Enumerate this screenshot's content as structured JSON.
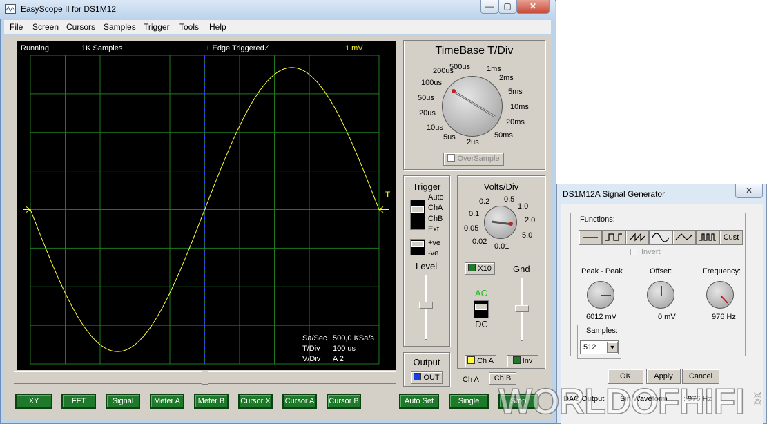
{
  "window": {
    "title": "EasyScope II for DS1M12",
    "minimize": "—",
    "maximize": "▢",
    "close": "✕"
  },
  "menu": [
    "File",
    "Screen",
    "Cursors",
    "Samples",
    "Trigger",
    "Tools",
    "Help"
  ],
  "screen": {
    "status": "Running",
    "samples": "1K Samples",
    "trigger": "+ Edge Triggered  ⁄",
    "volts": "1 mV",
    "trigger_marker": "T",
    "info": [
      {
        "label": "Sa/Sec",
        "value": "500,0 KSa/s"
      },
      {
        "label": "T/Div",
        "value": "100 us"
      },
      {
        "label": "V/Div",
        "value": "A 2"
      }
    ],
    "colors": {
      "grid": "#1f7a1f",
      "trace": "#ffff33",
      "axis": "#3b3bff",
      "marker": "#ffff33"
    }
  },
  "timebase": {
    "title": "TimeBase T/Div",
    "labels": [
      "500us",
      "1ms",
      "2ms",
      "5ms",
      "10ms",
      "20ms",
      "50ms",
      "2us",
      "5us",
      "10us",
      "20us",
      "50us",
      "100us",
      "200us"
    ],
    "oversample": "OverSample"
  },
  "trigger": {
    "title": "Trigger",
    "modes": [
      "Auto",
      "ChA",
      "ChB",
      "Ext"
    ],
    "slopes": [
      "+ve",
      "-ve"
    ],
    "level": "Level"
  },
  "volts": {
    "title": "Volts/Div",
    "labels": [
      "0.2",
      "0.5",
      "1.0",
      "2.0",
      "5.0",
      "0.01",
      "0.02",
      "0.05",
      "0.1"
    ],
    "x10": "X10",
    "gnd": "Gnd",
    "ac": "AC",
    "dc": "DC",
    "cha": "Ch A",
    "inv": "Inv"
  },
  "output": {
    "title": "Output",
    "out": "OUT"
  },
  "channel_tabs": [
    "Ch A",
    "Ch B"
  ],
  "buttons": [
    "XY",
    "FFT",
    "Signal",
    "Meter A",
    "Meter B",
    "Cursor X",
    "Cursor A",
    "Cursor B",
    "Auto Set",
    "Single",
    "Stop"
  ],
  "siggen": {
    "title": "DS1M12A Signal Generator",
    "close": "✕",
    "functions_label": "Functions:",
    "cust": "Cust",
    "invert": "Invert",
    "knobs": [
      {
        "label": "Peak - Peak",
        "value": "6012 mV"
      },
      {
        "label": "Offset:",
        "value": "0 mV"
      },
      {
        "label": "Frequency:",
        "value": "976 Hz"
      }
    ],
    "samples_label": "Samples:",
    "samples_value": "512",
    "ok": "OK",
    "apply": "Apply",
    "cancel": "Cancel",
    "status": [
      "DAC Output",
      "Sin Waveform",
      ": 976 Hz"
    ]
  },
  "watermark": {
    "text": "WORLDOFHIFI",
    "suffix": "DK"
  }
}
